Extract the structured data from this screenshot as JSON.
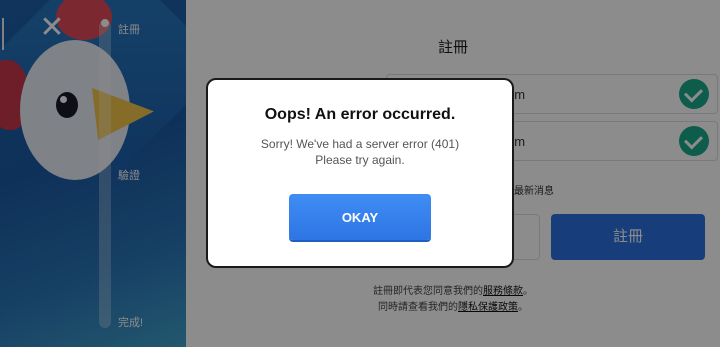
{
  "left_panel": {
    "steps": [
      {
        "label": "註冊"
      },
      {
        "label": "驗證"
      },
      {
        "label": "完成!"
      }
    ]
  },
  "form": {
    "title": "註冊",
    "fields": [
      {
        "value": "om"
      },
      {
        "value": "om"
      }
    ],
    "news_label": "的最新消息",
    "register_label": "註冊",
    "legal": {
      "line1_prefix": "註冊即代表您同意我們的",
      "terms_link": "服務條款",
      "line1_suffix": "。",
      "line2_prefix": "同時請查看我們的",
      "privacy_link": "隱私保護政策",
      "line2_suffix": "。"
    }
  },
  "modal": {
    "title": "Oops! An error occurred.",
    "message_line1": "Sorry! We've had a server error (401)",
    "message_line2": "Please try again.",
    "button_label": "OKAY"
  },
  "icons": {
    "close": "close-icon",
    "check": "check-icon"
  },
  "colors": {
    "accent_blue": "#2a72e0",
    "check_green": "#1aa88a",
    "panel_blue": "#1f5fa8"
  }
}
